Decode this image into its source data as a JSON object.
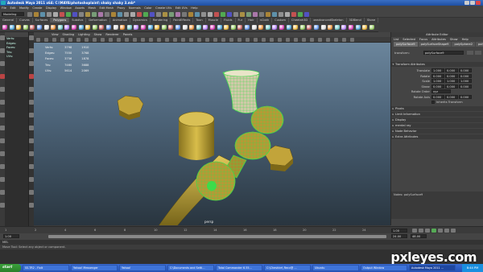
{
  "window": {
    "title": "Autodesk Maya 2011 x64: C:\\MAYA\\photoshoplaint\\ shaky shaky 3.mb*"
  },
  "menubar": [
    "File",
    "Edit",
    "Modify",
    "Create",
    "Display",
    "Window",
    "Assets",
    "Mesh",
    "Edit Mesh",
    "Proxy",
    "Normals",
    "Color",
    "Create UVs",
    "Edit UVs",
    "Help"
  ],
  "statusline": {
    "mode": "Modeling"
  },
  "shelf": {
    "tabs": [
      "General",
      "Curves",
      "Surfaces",
      "Polygons",
      "Subdivs",
      "Deformation",
      "Animation",
      "Dynamics",
      "Rendering",
      "PaintEffects",
      "Toon",
      "Muscle",
      "Fluids",
      "Fur",
      "Hair",
      "nCloth",
      "Custom",
      "Cheetah3D",
      "xeadvancedSkeleton",
      "3DBlend",
      "Stone"
    ],
    "active_index": 3
  },
  "viewport": {
    "menu": [
      "View",
      "Shading",
      "Lighting",
      "Show",
      "Renderer",
      "Panels"
    ],
    "hud": [
      {
        "label": "Verts:",
        "a": "3798",
        "b": "1910"
      },
      {
        "label": "Edges:",
        "a": "7550",
        "b": "3768"
      },
      {
        "label": "Faces:",
        "a": "3756",
        "b": "1878"
      },
      {
        "label": "Tris:",
        "a": "7460",
        "b": "3688"
      },
      {
        "label": "UVs:",
        "a": "5614",
        "b": "2069"
      }
    ],
    "camera": "persp"
  },
  "outliner": {
    "items": [
      "Verts:",
      "Edges:",
      "Faces:",
      "Tris:",
      "UVs:"
    ]
  },
  "attribute_editor": {
    "title": "Attribute Editor",
    "menu": [
      "List",
      "Selected",
      "Focus",
      "Attributes",
      "Show",
      "Help"
    ],
    "tabs": [
      "polySurface9",
      "polySurfaceShape9",
      "polySphere2",
      "polyCylinder3"
    ],
    "active_tab": 0,
    "transform_label": "transform:",
    "transform_value": "polySurface9",
    "sections": {
      "transform": "Transform Attributes",
      "rows": [
        {
          "label": "Translate",
          "v": [
            "1.000",
            "0.000",
            "0.000"
          ]
        },
        {
          "label": "Rotate",
          "v": [
            "0.000",
            "0.000",
            "0.000"
          ]
        },
        {
          "label": "Scale",
          "v": [
            "1.000",
            "1.000",
            "1.000"
          ]
        },
        {
          "label": "Shear",
          "v": [
            "0.000",
            "0.000",
            "0.000"
          ]
        },
        {
          "label": "Rotate Order",
          "v": [
            "xyz"
          ]
        },
        {
          "label": "Rotate Axis",
          "v": [
            "0.000",
            "0.000",
            "0.000"
          ]
        }
      ],
      "inherits": "Inherits Transform",
      "collapsed": [
        "Pivots",
        "Limit Information",
        "Display",
        "mental ray",
        "Node Behavior",
        "Extra Attributes"
      ]
    },
    "notes_label": "Notes: polySurface9",
    "buttons": [
      "Select",
      "Load Attributes",
      "Copy Tab"
    ]
  },
  "timeslider": {
    "ticks": [
      "1",
      "2",
      "4",
      "6",
      "8",
      "10",
      "12",
      "14",
      "16",
      "18",
      "20",
      "22",
      "24"
    ],
    "current": "1.00"
  },
  "range": {
    "start": "1.00",
    "end": "24.00",
    "a": "48.00"
  },
  "cmdline": "MEL",
  "helpline": "Move Tool: Select any object or component.",
  "taskbar": {
    "start": "start",
    "items": [
      "SS-TR2 - FixIt",
      "Yahoo! Messenger",
      "Yahoo!",
      "C:\\Documents and Setti...",
      "Total Commander 6.55...",
      "C:\\Cheshire\\ Recv@ ...",
      "Ubuntu",
      "Output Window",
      "Autodesk Maya 2011 ..."
    ],
    "active_index": 8,
    "clock": "8:44 PM"
  },
  "watermark": "pxleyes.com",
  "colors": {
    "mesh": "#c7a93a",
    "wire": "#3ddc4a",
    "viewport_top": "#6f8aa1",
    "viewport_bottom": "#29353f"
  }
}
